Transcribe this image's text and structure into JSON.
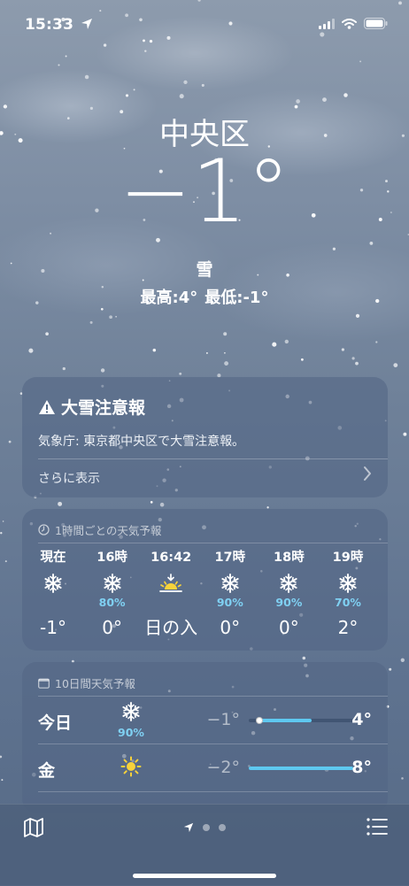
{
  "status_bar": {
    "time": "15:33",
    "icons": [
      "location-arrow-icon",
      "cellular-signal-icon",
      "wifi-icon",
      "battery-icon"
    ]
  },
  "hero": {
    "city": "中央区",
    "temperature": "−1°",
    "condition": "雪",
    "high": "最高:4°",
    "low": "最低:-1°"
  },
  "alert": {
    "icon": "warning-triangle-icon",
    "title": "大雪注意報",
    "body": "気象庁: 東京都中央区で大雪注意報。",
    "more": "さらに表示",
    "chevron": "chevron-right-icon"
  },
  "hourly": {
    "header_icon": "clock-icon",
    "header": "1時間ごとの天気予報",
    "items": [
      {
        "label": "現在",
        "icon": "snowflake-icon",
        "pop": "",
        "temp": "-1°"
      },
      {
        "label": "16時",
        "icon": "snowflake-icon",
        "pop": "80%",
        "temp": "0°"
      },
      {
        "label": "16:42",
        "icon": "sunset-icon",
        "pop": "",
        "temp": "日の入"
      },
      {
        "label": "17時",
        "icon": "snowflake-icon",
        "pop": "90%",
        "temp": "0°"
      },
      {
        "label": "18時",
        "icon": "snowflake-icon",
        "pop": "90%",
        "temp": "0°"
      },
      {
        "label": "19時",
        "icon": "snowflake-icon",
        "pop": "70%",
        "temp": "2°"
      }
    ]
  },
  "daily": {
    "header_icon": "calendar-icon",
    "header": "10日間天気予報",
    "range_min": -2,
    "range_max": 8,
    "current_temp": -1,
    "items": [
      {
        "day": "今日",
        "icon": "snowflake-icon",
        "pop": "90%",
        "low": "−1°",
        "high": "4°",
        "low_value": -1,
        "high_value": 4
      },
      {
        "day": "金",
        "icon": "sun-icon",
        "pop": "",
        "low": "−2°",
        "high": "8°",
        "low_value": -2,
        "high_value": 8
      }
    ]
  },
  "bottom_bar": {
    "left_icon": "map-icon",
    "right_icon": "list-icon",
    "page_indicator": [
      "location-arrow-icon",
      "page-dot",
      "page-dot"
    ]
  },
  "colors": {
    "precip_blue": "#7fd0f2",
    "temp_bar": "#5ec8f0",
    "sun_yellow": "#f7d23a",
    "warning": "#ffffff"
  }
}
